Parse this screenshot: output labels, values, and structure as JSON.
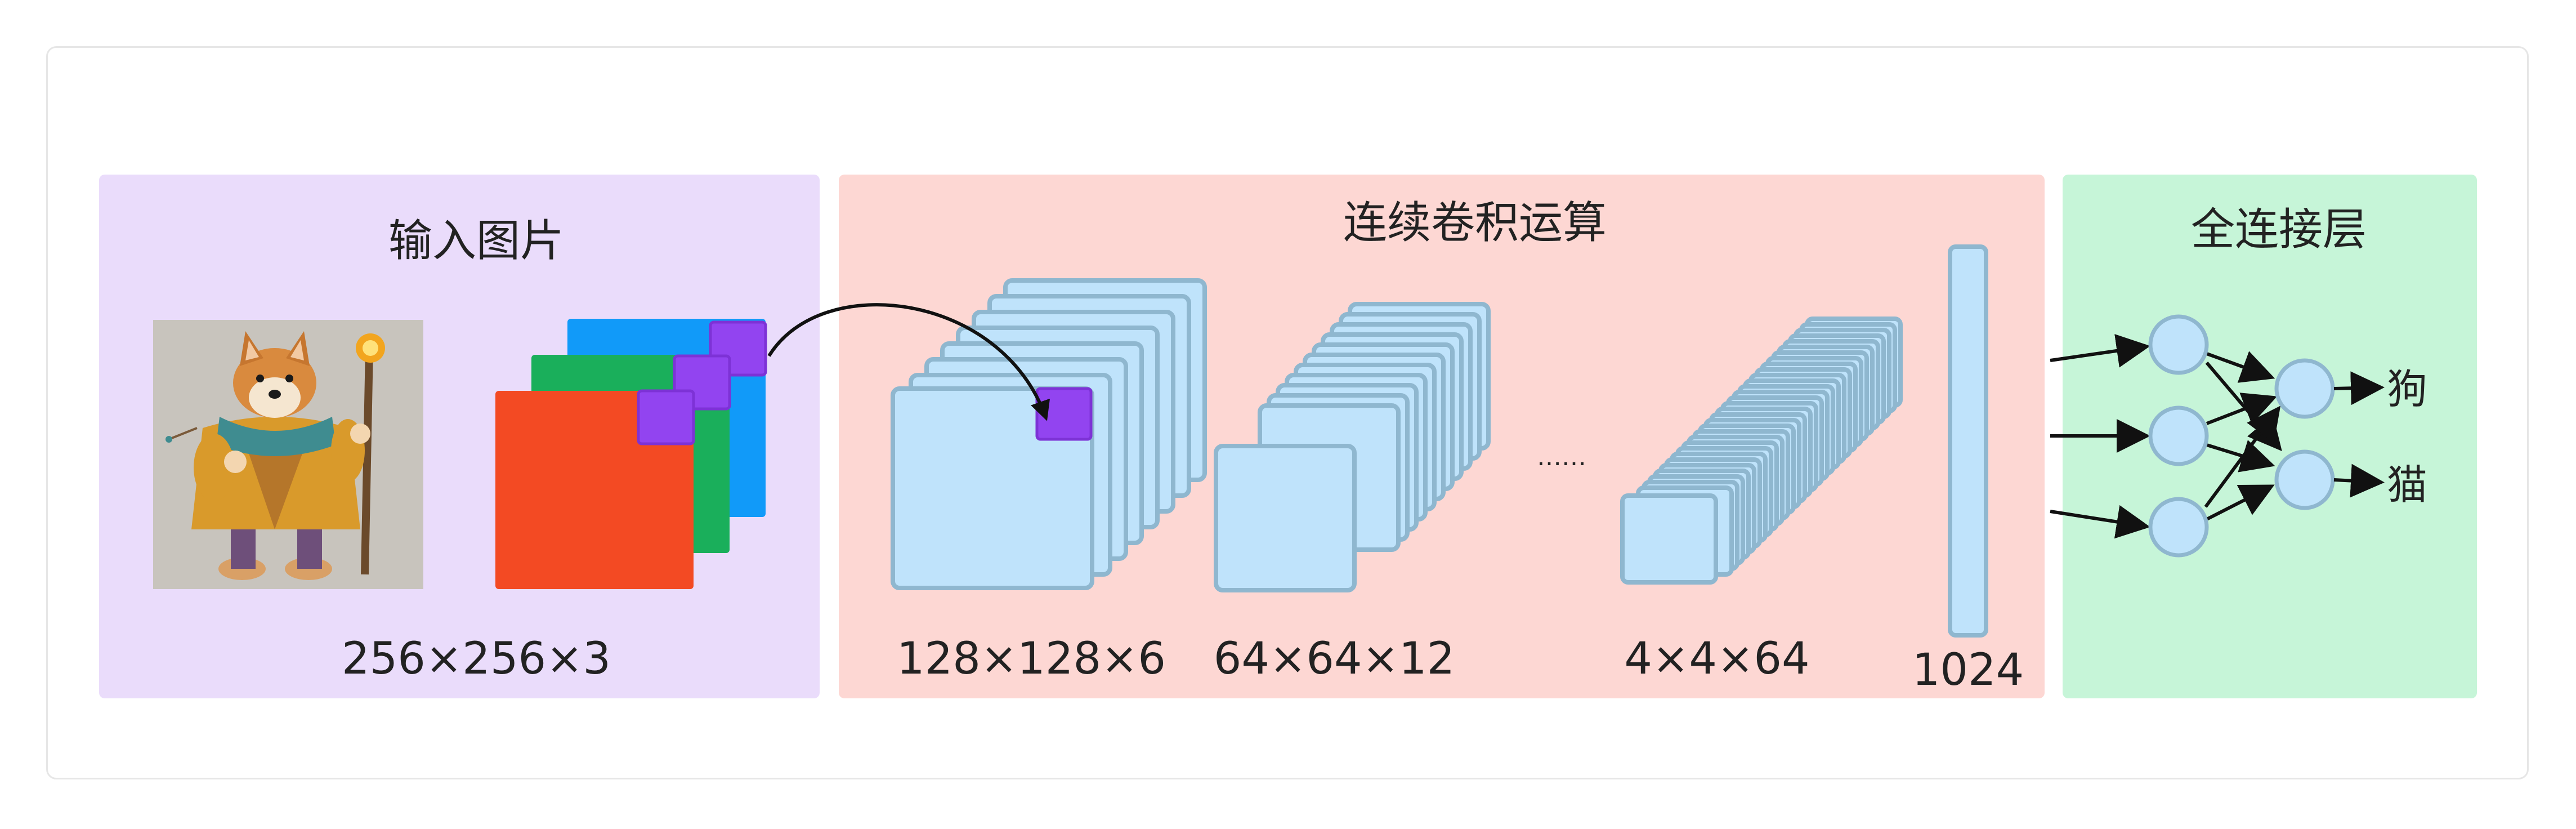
{
  "panels": {
    "input": {
      "title": "输入图片",
      "dims": "256×256×3",
      "bg": "#eadcfb"
    },
    "conv": {
      "title": "连续卷积运算",
      "bg": "#fdd7d3",
      "dims": [
        "128×128×6",
        "64×64×12",
        "4×4×64",
        "1024"
      ],
      "ellipsis": "……"
    },
    "fc": {
      "title": "全连接层",
      "bg": "#c6f5d8",
      "outputs": [
        "狗",
        "猫"
      ]
    }
  },
  "colors": {
    "channel_red": "#f34a23",
    "channel_green": "#1aaf5b",
    "channel_blue": "#119af9",
    "kernel": "#9244f0",
    "layer_fill": "#bfe3fb",
    "layer_stroke": "#8fb7cf"
  },
  "image": {
    "subject": "corgi-wizard-illustration"
  }
}
